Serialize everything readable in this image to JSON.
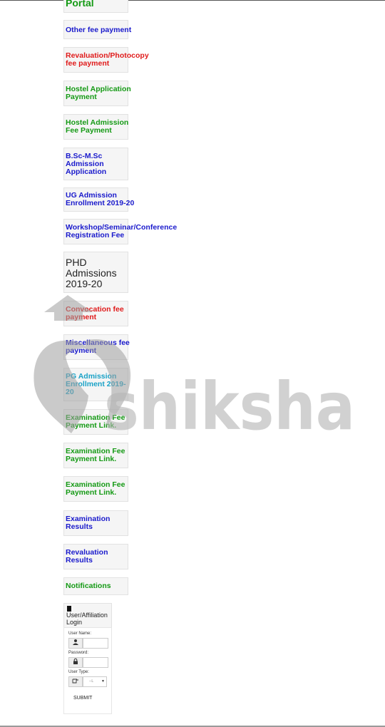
{
  "links": [
    {
      "label": "Portal",
      "color": "#159a15"
    },
    {
      "label": "Other fee payment",
      "color": "#1a1acc"
    },
    {
      "label": "Revaluation/Photocopy\nfee payment",
      "color": "#e01b1b"
    },
    {
      "label": "Hostel Application\nPayment",
      "color": "#159a15"
    },
    {
      "label": "Hostel Admission\nFee Payment",
      "color": "#159a15"
    },
    {
      "label": "B.Sc-M.Sc\nAdmission\nApplication",
      "color": "#1a1acc"
    },
    {
      "label": "UG Admission\nEnrollment 2019-20",
      "color": "#1a1acc"
    },
    {
      "label": "Workshop/Seminar/Conference\nRegistration Fee",
      "color": "#1a1acc"
    },
    {
      "label": "PHD\nAdmissions\n2019-20",
      "color": "#222222"
    },
    {
      "label": "Convocation fee\npayment",
      "color": "#e01b1b"
    },
    {
      "label": "Miscellaneous fee\npayment",
      "color": "#1a1acc"
    },
    {
      "label": "PG Admission\nEnrollment 2019-\n20",
      "color": "#1aa2c7"
    },
    {
      "label": "Examination Fee\nPayment Link.",
      "color": "#159a15"
    },
    {
      "label": "Examination Fee\nPayment Link.",
      "color": "#159a15"
    },
    {
      "label": "Examination Fee\nPayment Link.",
      "color": "#159a15"
    },
    {
      "label": "Examination\nResults",
      "color": "#1a1acc"
    },
    {
      "label": "Revaluation\nResults",
      "color": "#1a1acc"
    },
    {
      "label": "Notifications",
      "color": "#159a15"
    }
  ],
  "login": {
    "title": "User/Affiliation\nLogin",
    "username_label": "User Name:",
    "password_label": "Password:",
    "usertype_label": "User Type:",
    "usertype_selected": "--L",
    "submit_label": "SUBMIT",
    "icons": [
      "user-icon",
      "lock-icon",
      "hand-pointer-icon",
      "bookmark-icon"
    ]
  },
  "watermark": {
    "text": "shiksha",
    "color": "#b5b5b5"
  }
}
